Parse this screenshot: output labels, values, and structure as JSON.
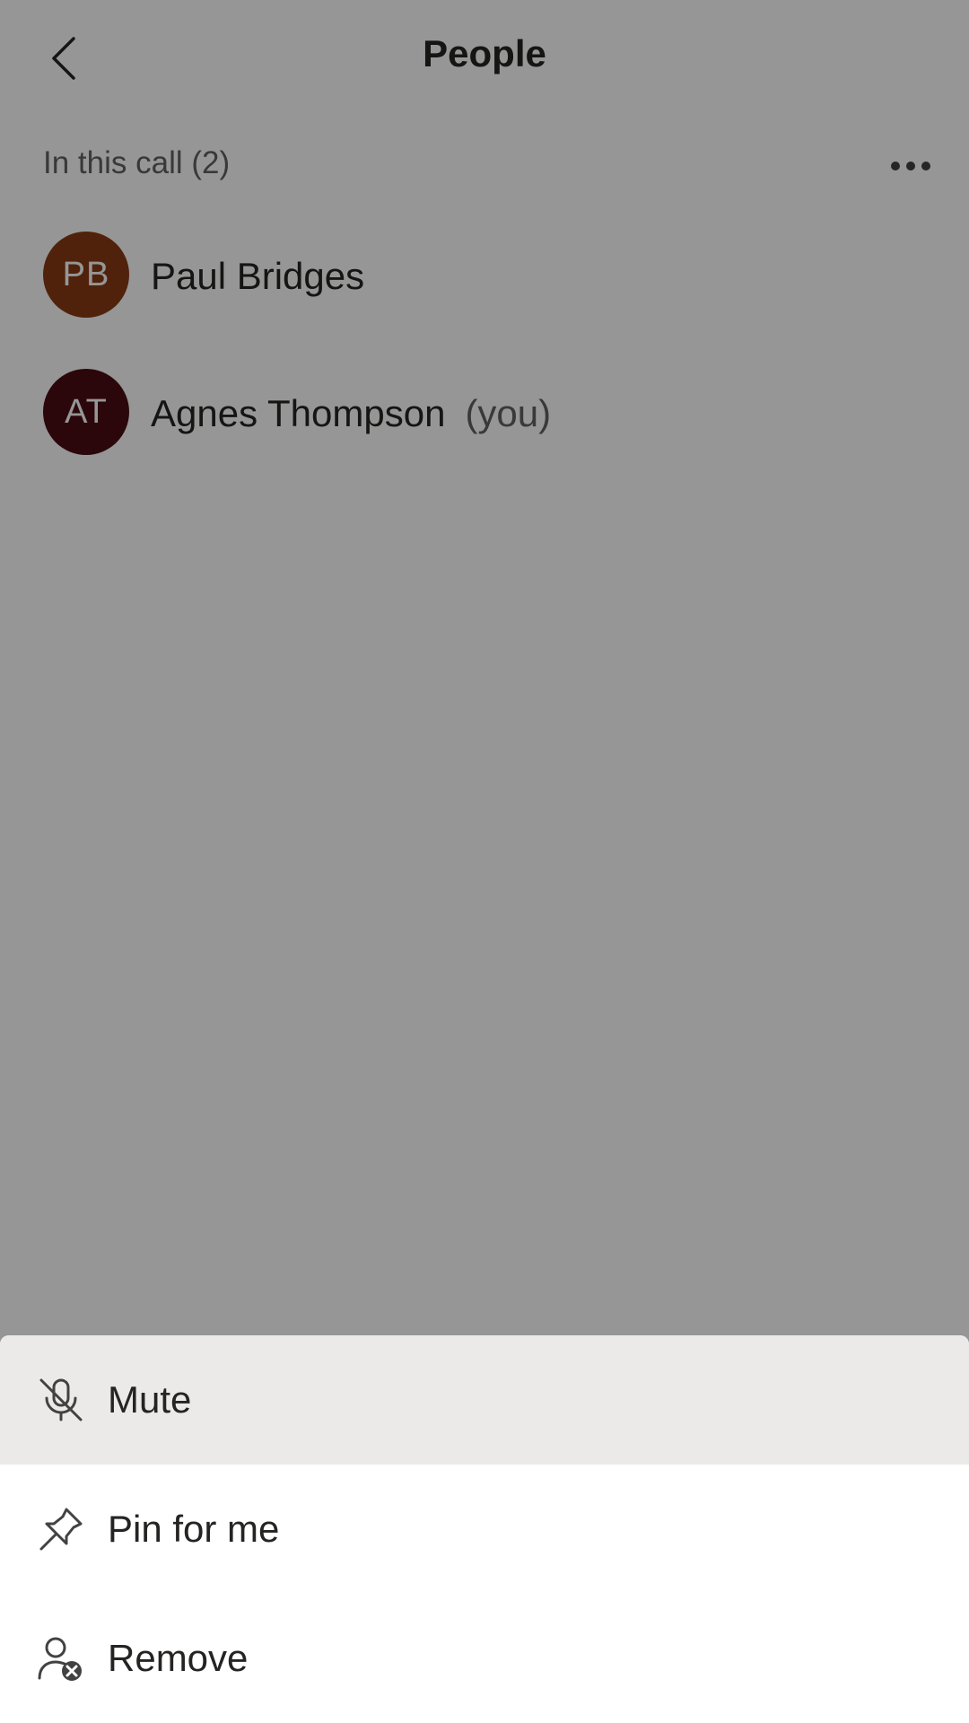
{
  "header": {
    "title": "People",
    "back_icon": "chevron-left-icon"
  },
  "section": {
    "title": "In this call (2)",
    "more_icon": "more-horizontal-icon"
  },
  "participants": [
    {
      "initials": "PB",
      "name": "Paul Bridges",
      "suffix": "",
      "avatar_color": "#8a3a14"
    },
    {
      "initials": "AT",
      "name": "Agnes Thompson",
      "suffix": "(you)",
      "avatar_color": "#4a0d15"
    }
  ],
  "menu": {
    "items": [
      {
        "label": "Mute",
        "icon": "microphone-off-icon"
      },
      {
        "label": "Pin for me",
        "icon": "pin-icon"
      },
      {
        "label": "Remove",
        "icon": "person-remove-icon"
      }
    ]
  },
  "colors": {
    "overlay": "#999999",
    "sheet_highlight": "#ebeae9",
    "text_primary": "#252423",
    "text_secondary": "#616161"
  }
}
